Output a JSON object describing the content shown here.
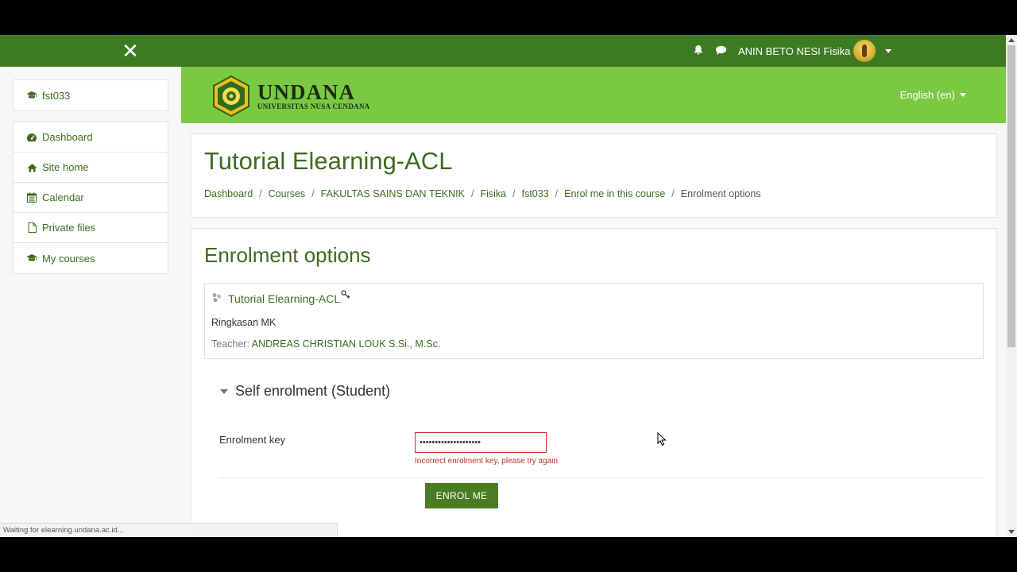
{
  "topnav": {
    "user_name": "ANIN BETO NESI Fisika",
    "icons": [
      "close-icon",
      "bell-icon",
      "chat-icon"
    ]
  },
  "sidebar": {
    "course_short": "fst033",
    "items": [
      {
        "label": "Dashboard",
        "icon": "dashboard-icon"
      },
      {
        "label": "Site home",
        "icon": "home-icon"
      },
      {
        "label": "Calendar",
        "icon": "calendar-icon"
      },
      {
        "label": "Private files",
        "icon": "file-icon"
      },
      {
        "label": "My courses",
        "icon": "graduation-cap-icon"
      }
    ]
  },
  "header": {
    "logo_main": "UNDANA",
    "logo_sub": "UNIVERSITAS NUSA CENDANA",
    "language": "English (en)"
  },
  "page": {
    "title": "Tutorial Elearning-ACL",
    "breadcrumb": [
      "Dashboard",
      "Courses",
      "FAKULTAS SAINS DAN TEKNIK",
      "Fisika",
      "fst033",
      "Enrol me in this course",
      "Enrolment options"
    ]
  },
  "enrolment": {
    "title": "Enrolment options",
    "course_name": "Tutorial Elearning-ACL",
    "summary": "Ringkasan MK",
    "teacher_label": "Teacher:",
    "teacher_name": "ANDREAS CHRISTIAN LOUK S.Si., M.Sc.",
    "section_title": "Self enrolment (Student)",
    "key_label": "Enrolment key",
    "key_value": "••••••••••••••••••••",
    "error": "Incorrect enrolment key, please try again",
    "button": "ENROL ME"
  },
  "status_bar": "Waiting for elearning.undana.ac.id...",
  "colors": {
    "primary_dark": "#3e7a22",
    "header_green": "#7ac943",
    "link_green": "#3e6b1f",
    "error_red": "#ca3120"
  }
}
